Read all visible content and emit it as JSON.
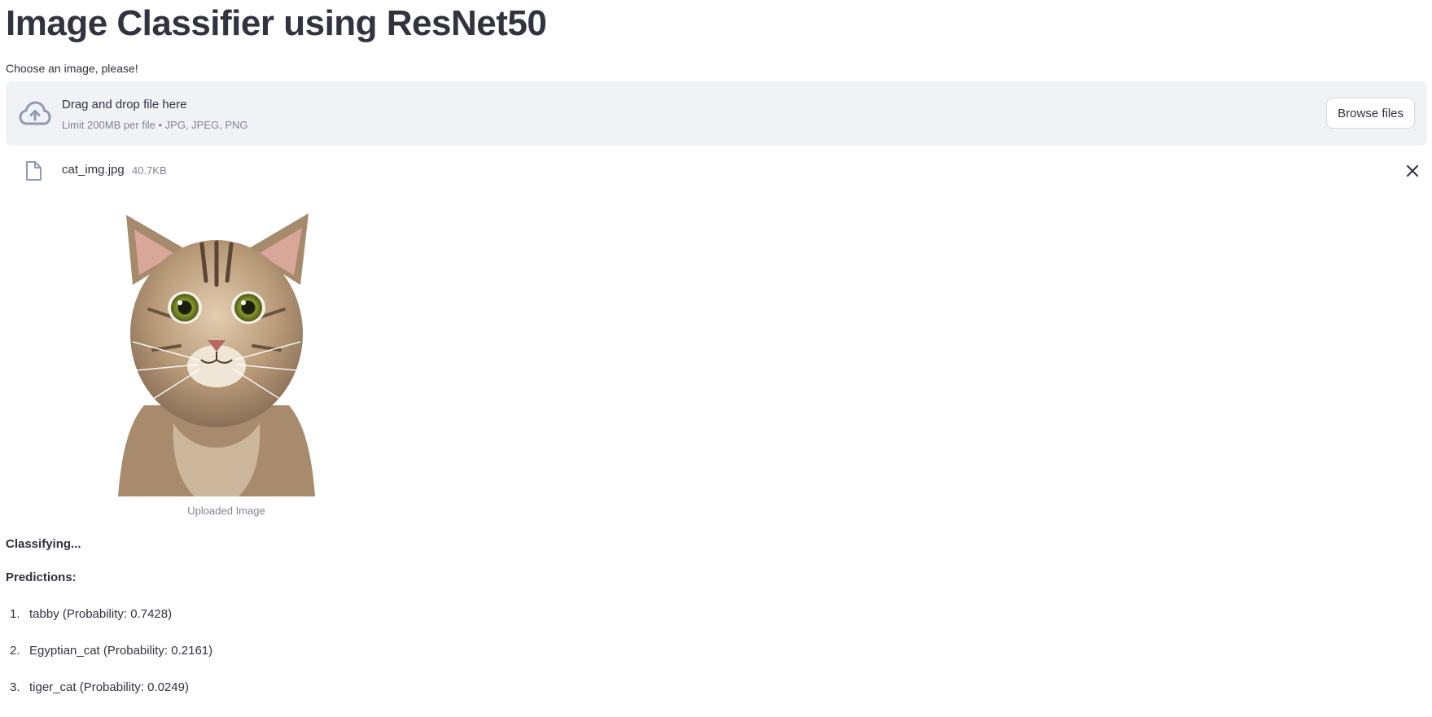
{
  "page": {
    "title": "Image Classifier using ResNet50"
  },
  "uploader": {
    "label": "Choose an image, please!",
    "drop_title": "Drag and drop file here",
    "drop_hint": "Limit 200MB per file • JPG, JPEG, PNG",
    "browse_label": "Browse files",
    "icon": "cloud-upload-icon"
  },
  "file": {
    "name": "cat_img.jpg",
    "size": "40.7KB",
    "icon": "file-icon",
    "remove_icon": "close-icon"
  },
  "image": {
    "caption": "Uploaded Image"
  },
  "results": {
    "status": "Classifying...",
    "heading": "Predictions:",
    "items": [
      {
        "num": "1.",
        "text": "tabby (Probability: 0.7428)"
      },
      {
        "num": "2.",
        "text": "Egyptian_cat (Probability: 0.2161)"
      },
      {
        "num": "3.",
        "text": "tiger_cat (Probability: 0.0249)"
      }
    ]
  },
  "colors": {
    "text": "#31333f",
    "muted": "#808495",
    "dropzone_bg": "#f0f2f6"
  }
}
